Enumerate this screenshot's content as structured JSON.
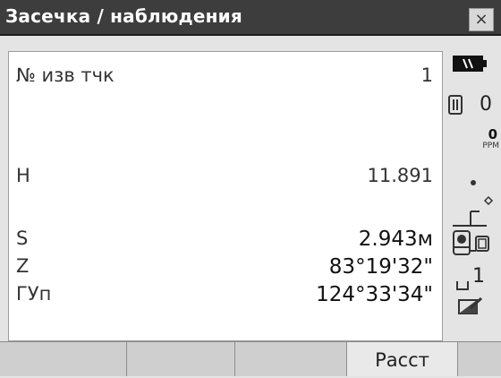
{
  "window": {
    "title": "Засечка / наблюдения",
    "close_glyph": "×"
  },
  "fields": [
    {
      "label": "№ изв тчк",
      "value": "1"
    },
    {
      "label": "H",
      "value": "11.891"
    },
    {
      "label": "S",
      "value": "2.943м"
    },
    {
      "label": "Z",
      "value": "83°19'32\""
    },
    {
      "label": "ГУп",
      "value": "124°33'34\""
    }
  ],
  "status": {
    "battery_icon": "battery-icon",
    "target_value": "0",
    "ppm_value": "0",
    "ppm_unit": "PPM",
    "prism_icon": "prism-icon",
    "tilt_icon": "tilt-compensation-icon",
    "instrument_icon": "instrument-icon",
    "face_value": "1",
    "input_icon": "input-mode-icon"
  },
  "softkeys": [
    "",
    "",
    "",
    "Расст",
    ""
  ],
  "colors": {
    "titlebar": "#3d3d3d",
    "panel": "#ffffff",
    "background": "#e4e4e4"
  }
}
